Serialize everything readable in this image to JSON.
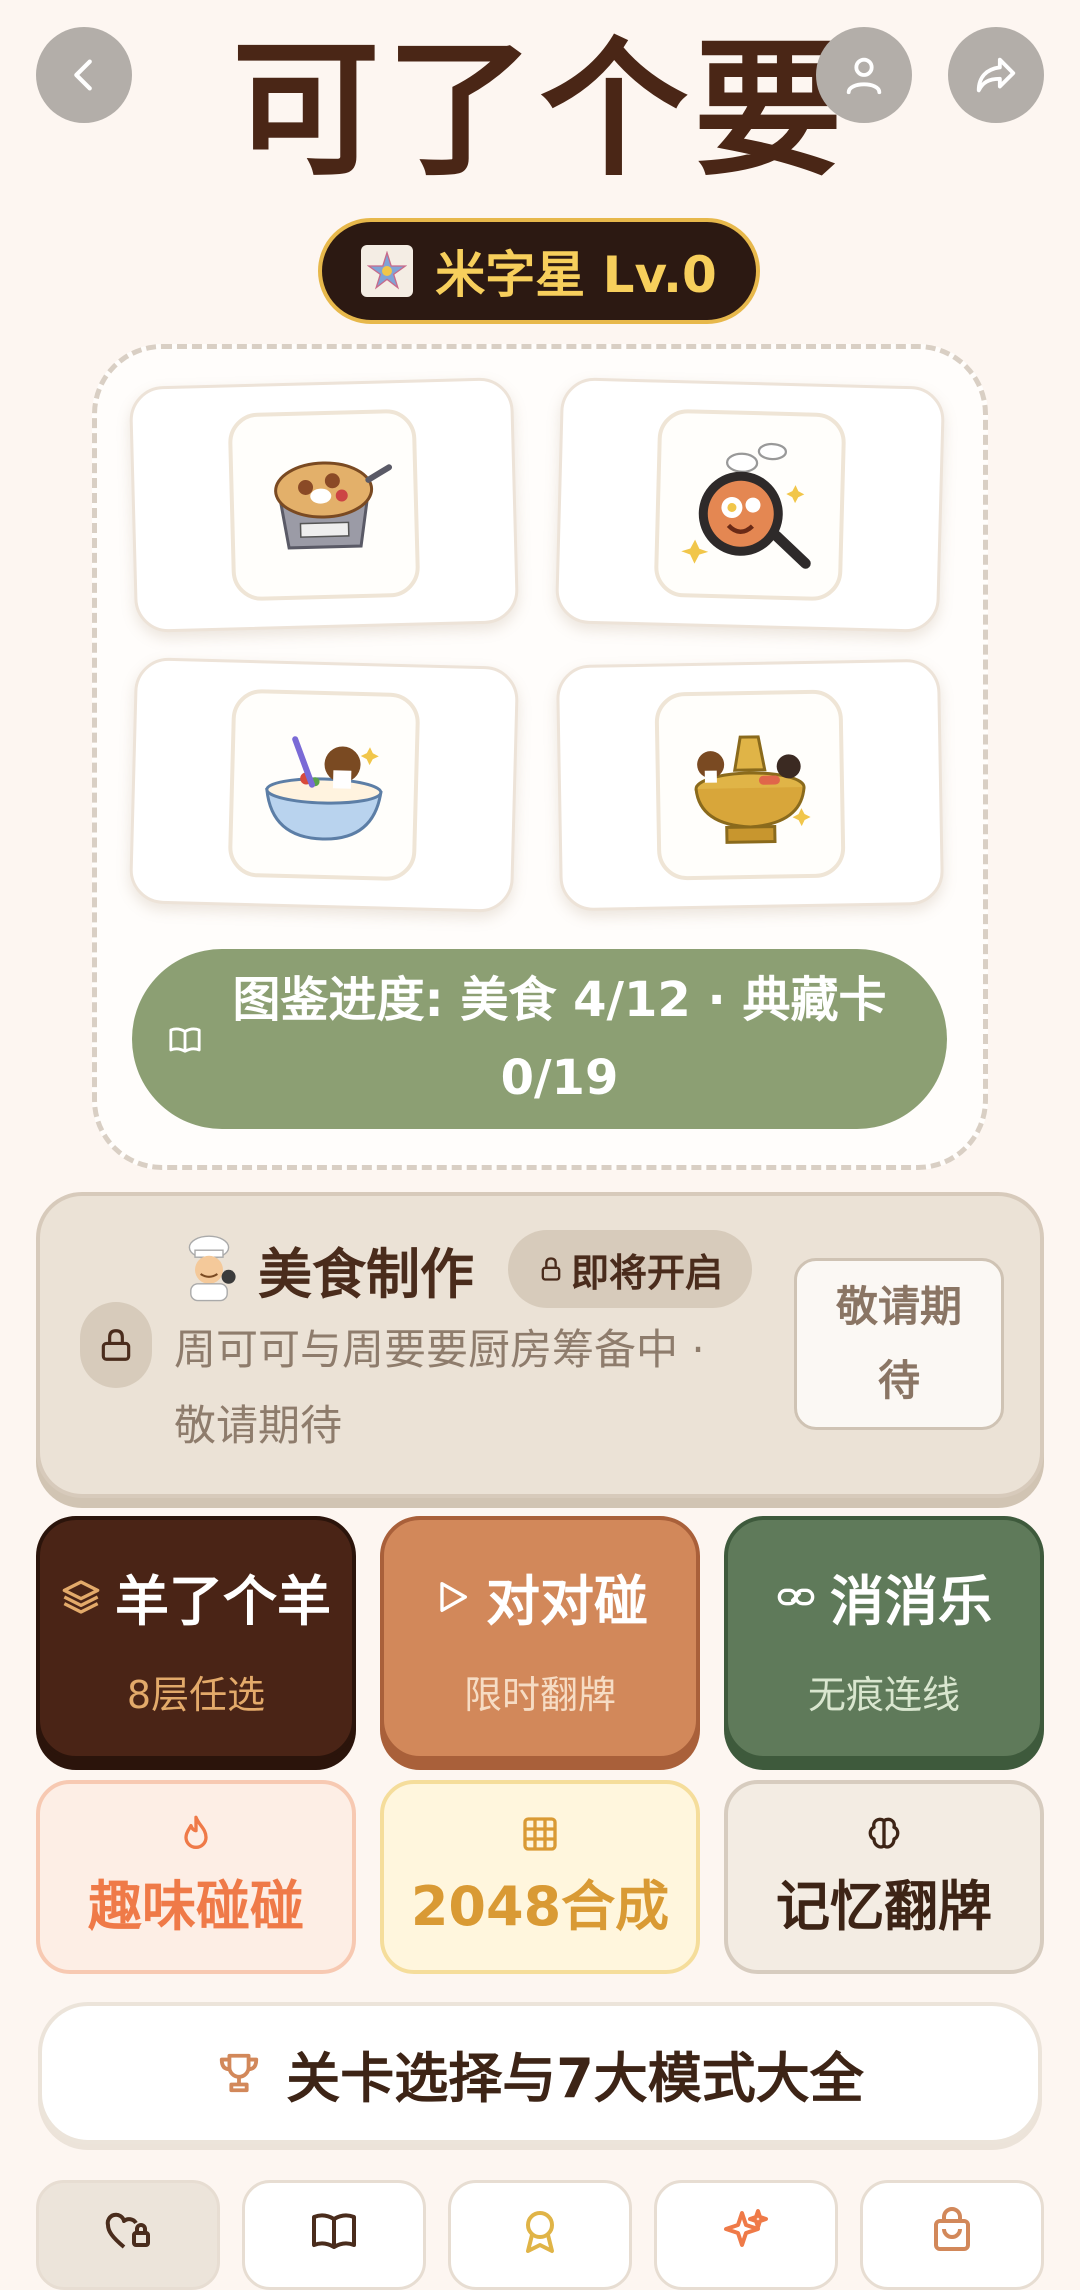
{
  "header": {
    "title": "可了个要"
  },
  "level_badge": {
    "text": "米字星 Lv.0"
  },
  "collection": {
    "progress_text": "图鉴进度: 美食 4/12 · 典藏卡 0/19"
  },
  "cooking": {
    "title": "美食制作",
    "soon_tag": "即将开启",
    "description": "周可可与周要要厨房筹备中 · 敬请期待",
    "wait_button": "敬请期待"
  },
  "modes": [
    {
      "name": "羊了个羊",
      "sub": "8层任选",
      "bg": "#4a2416",
      "sub_color": "#e3aa6a"
    },
    {
      "name": "对对碰",
      "sub": "限时翻牌",
      "bg": "#d2885a",
      "sub_color": "#f6dcc4"
    },
    {
      "name": "消消乐",
      "sub": "无痕连线",
      "bg": "#5f7a5a",
      "sub_color": "#d9e6cf"
    }
  ],
  "minigames": [
    {
      "name": "趣味碰碰",
      "color": "#ef7a48",
      "bg": "#fdeee5",
      "border": "#f7c9b2"
    },
    {
      "name": "2048合成",
      "color": "#d99a34",
      "bg": "#fff6dd",
      "border": "#f5dd9b"
    },
    {
      "name": "记忆翻牌",
      "color": "#3d2416",
      "bg": "#f3ece3",
      "border": "#d7ccbf"
    }
  ],
  "levels_button": {
    "label": "关卡选择与7大模式大全"
  },
  "icons": [
    "back-icon",
    "user-icon",
    "share-icon",
    "star-icon",
    "book-icon",
    "lock-icon",
    "chef-icon",
    "layers-icon",
    "play-icon",
    "link-icon",
    "flame-icon",
    "grid-icon",
    "brain-icon",
    "trophy-icon",
    "heart-lock-icon",
    "award-icon",
    "sparkle-icon",
    "bag-icon"
  ]
}
